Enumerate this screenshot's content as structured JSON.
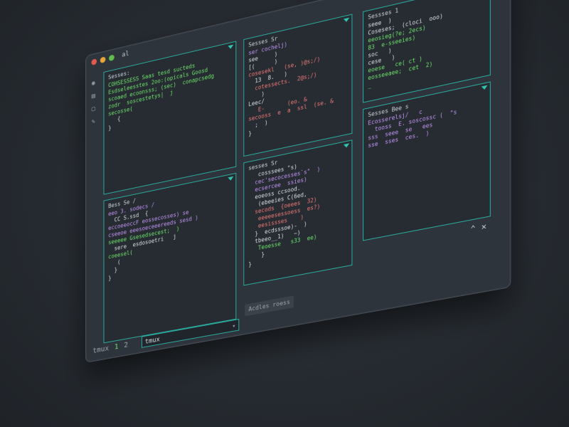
{
  "window": {
    "title": "al",
    "maximize_icon": "maximize-icon",
    "close_icon": "close-icon",
    "collapse_icon": "chevron-up-icon"
  },
  "sidebar": {
    "icons": [
      "terminal-icon",
      "folder-icon",
      "square-icon",
      "pencil-icon"
    ]
  },
  "panes": [
    {
      "title": "Sesses:",
      "lines": [
        {
          "text": "COHSESSESS Saas tesd sucteds",
          "color": "green"
        },
        {
          "text": "Esdseleesstes 2oo:(opicals Goosd",
          "color": "green"
        },
        {
          "text": "scoaed ecoonsss; (sec)  conapcsedg",
          "color": "green"
        },
        {
          "text": "zodr  soscestetys|  j",
          "color": "green"
        },
        {
          "text": "secosse(",
          "color": "green"
        },
        {
          "text": "   {",
          "color": "white"
        },
        {
          "text": "",
          "color": "white"
        },
        {
          "text": "",
          "color": "white"
        },
        {
          "text": "",
          "color": "white"
        },
        {
          "text": "",
          "color": "white"
        },
        {
          "text": "}",
          "color": "white"
        }
      ]
    },
    {
      "title": "Sesses Sr",
      "lines": [
        {
          "text": "ser cochelj)",
          "color": "purple"
        },
        {
          "text": "see     )",
          "color": "white"
        },
        {
          "text": "[(      )",
          "color": "white"
        },
        {
          "text": "cosesekl   (se, )@s;/)",
          "color": "red"
        },
        {
          "text": "  13  8.   )",
          "color": "white"
        },
        {
          "text": "  cotessects.  2@s;/)",
          "color": "red"
        },
        {
          "text": "    )",
          "color": "white"
        },
        {
          "text": "",
          "color": "white"
        },
        {
          "text": "Leec/",
          "color": "white"
        },
        {
          "text": "   E-       (eo. &",
          "color": "red"
        },
        {
          "text": "secooss  e  a  ssl  (se. &",
          "color": "red"
        },
        {
          "text": "  ;  )",
          "color": "white"
        },
        {
          "text": "}",
          "color": "white"
        }
      ]
    },
    {
      "title": "Sessses 1",
      "lines": [
        {
          "text": "seee  )",
          "color": "white"
        },
        {
          "text": "Coseses;  (cloci  ooo)",
          "color": "white"
        },
        {
          "text": "eeosieg(?e; 2ecs)",
          "color": "green"
        },
        {
          "text": "83  e-sseeies)",
          "color": "green"
        },
        {
          "text": "soc   )",
          "color": "white"
        },
        {
          "text": "cese   )",
          "color": "white"
        },
        {
          "text": "eoese   ce( ct )",
          "color": "green"
        },
        {
          "text": "eosseeaee;  cet  2)",
          "color": "green"
        },
        {
          "text": "",
          "color": "white"
        },
        {
          "text": "_",
          "color": "green"
        }
      ]
    },
    {
      "title": "Bess  Se /",
      "lines": [
        {
          "text": "eeo 3. sodecs /",
          "color": "purple"
        },
        {
          "text": "  CC S.ssd  {",
          "color": "white"
        },
        {
          "text": "eccoeeoccF eossecosses) se",
          "color": "purple"
        },
        {
          "text": "cseeoe eeesoeceeereeds sesd )",
          "color": "purple"
        },
        {
          "text": "seeeee Gsesedsecest;  )",
          "color": "green"
        },
        {
          "text": "  sere  esdosoetri   j",
          "color": "white"
        },
        {
          "text": "coeesel(",
          "color": "green"
        },
        {
          "text": "   (",
          "color": "white"
        },
        {
          "text": "  }",
          "color": "white"
        },
        {
          "text": "",
          "color": "white"
        },
        {
          "text": "",
          "color": "white"
        },
        {
          "text": "",
          "color": "white"
        },
        {
          "text": "",
          "color": "white"
        },
        {
          "text": "}",
          "color": "white"
        }
      ]
    },
    {
      "title": "sesses Sr",
      "lines": [
        {
          "text": "   cosssees \"s)",
          "color": "white"
        },
        {
          "text": "  cec'secocesses`s\"  )",
          "color": "purple"
        },
        {
          "text": "  ecsercee  ssies)",
          "color": "purple"
        },
        {
          "text": "  eoeoss ccsood.",
          "color": "white"
        },
        {
          "text": "   (ebeeies C(6ed,",
          "color": "white"
        },
        {
          "text": "  secods  {oeees  32)",
          "color": "red"
        },
        {
          "text": "   eeeeesessoess  es?)",
          "color": "red"
        },
        {
          "text": "   eesissses    )",
          "color": "red"
        },
        {
          "text": "  }  ecdsssoe)-  )",
          "color": "white"
        },
        {
          "text": "  tbeeo__1)   ~)",
          "color": "white"
        },
        {
          "text": "",
          "color": "white"
        },
        {
          "text": "   Teoesse   s33  ee)",
          "color": "green"
        },
        {
          "text": "    }",
          "color": "white"
        },
        {
          "text": "}",
          "color": "white"
        }
      ]
    },
    {
      "title": "Sesses  Bee  s",
      "lines": [
        {
          "text": "Ecosserelsj/   c",
          "color": "purple"
        },
        {
          "text": "  tooss  E. soscossc (  \"s",
          "color": "purple"
        },
        {
          "text": "sss  seee  se   ees",
          "color": "purple"
        },
        {
          "text": "sse  sses  ces.  )",
          "color": "purple"
        }
      ]
    }
  ],
  "statusbar": {
    "label": "tmux",
    "window_1": "1",
    "window_2": "2",
    "input_value": "tmux",
    "dropdown_icon": "chevron-down-icon",
    "action_label": "Acdles roess"
  },
  "colors": {
    "accent": "#2aa89a",
    "green": "#6ee36b",
    "purple": "#c393f5",
    "red": "#f07878"
  }
}
